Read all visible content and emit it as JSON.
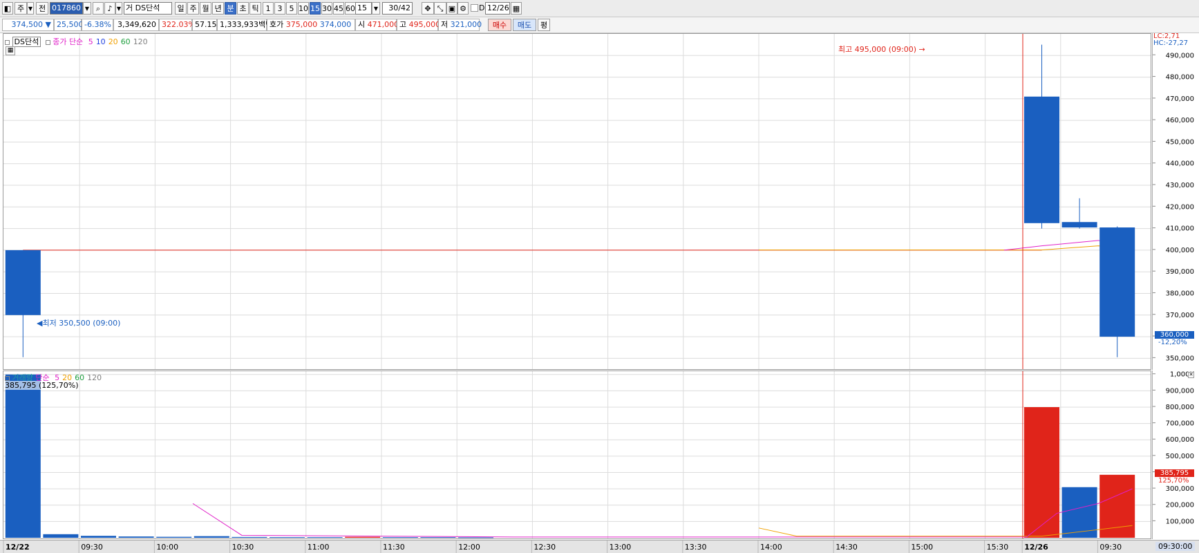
{
  "toolbar": {
    "market_label": "주",
    "jeon_label": "전",
    "code": "017860",
    "geo_label": "거",
    "stock_name": "DS단석",
    "period_buttons": [
      "일",
      "주",
      "월",
      "년",
      "분",
      "초",
      "틱"
    ],
    "period_selected": "분",
    "interval_buttons": [
      "1",
      "3",
      "5",
      "10",
      "15",
      "30",
      "45",
      "60"
    ],
    "interval_selected": "15",
    "interval_value": "15",
    "count": "30/42",
    "checkbox_label": "D",
    "date": "12/26"
  },
  "info": {
    "price": "374,500 ▼",
    "change": "25,500",
    "change_pct": "-6.38%",
    "volume": "3,349,620",
    "volume_ratio": "322.03%",
    "turnover": "57.15%",
    "amount": "1,333,933백만",
    "hoga_label": "호가",
    "ask": "375,000",
    "bid": "374,000",
    "open_label": "시",
    "open": "471,000",
    "high_label": "고",
    "high": "495,000",
    "low_label": "저",
    "low": "321,000",
    "buy_label": "매수",
    "sell_label": "매도",
    "eval_label": "평"
  },
  "price_pane": {
    "name": "DS단석",
    "ma_label": "종가 단순",
    "ma_periods": [
      "5",
      "10",
      "20",
      "60",
      "120"
    ],
    "ma_colors": [
      "#e020c8",
      "#2040e0",
      "#f0a000",
      "#20a040",
      "#808080"
    ],
    "lc_label": "LC:2,71",
    "hc_label": "HC:-27,27",
    "high_annotation": "최고 495,000 (09:00)",
    "low_annotation": "최저 350,500 (09:00)",
    "current_price_tag": "360,000",
    "current_pct_tag": "-12,20%"
  },
  "volume_pane": {
    "name": "거래량",
    "ma_label": "단순",
    "ma_periods": [
      "5",
      "20",
      "60",
      "120"
    ],
    "first_bar_label": "385,795 (125,70%)",
    "current_volume_tag": "385,795",
    "current_pct_tag": "125,70%"
  },
  "x_axis": {
    "labels": [
      "12/22",
      "09:30",
      "10:00",
      "10:30",
      "11:00",
      "11:30",
      "12:00",
      "12:30",
      "13:00",
      "13:30",
      "14:00",
      "14:30",
      "15:00",
      "15:30",
      "12/26",
      "09:30"
    ],
    "end_label": "09:30:00"
  },
  "colors": {
    "up": "#e0241a",
    "down": "#1a5fc0",
    "grid": "#dcdcdc"
  },
  "chart_data": [
    {
      "type": "candlestick",
      "title": "DS단석",
      "ylim": [
        345000,
        500000
      ],
      "yticks": [
        350000,
        360000,
        370000,
        380000,
        390000,
        400000,
        410000,
        420000,
        430000,
        440000,
        450000,
        460000,
        470000,
        480000,
        490000
      ],
      "ytick_labels": [
        "350,000",
        "360,000",
        "370,000",
        "380,000",
        "390,000",
        "400,000",
        "410,000",
        "420,000",
        "430,000",
        "440,000",
        "450,000",
        "460,000",
        "470,000",
        "480,000",
        "490,000"
      ],
      "candles": [
        {
          "slot": 0,
          "time": "12/22 09:00",
          "open": 400000,
          "high": 400000,
          "low": 350500,
          "close": 370000
        },
        {
          "slot": 27,
          "time": "12/26 09:00",
          "open": 471000,
          "high": 495000,
          "low": 410000,
          "close": 412500
        },
        {
          "slot": 28,
          "time": "12/26 09:15",
          "open": 413000,
          "high": 424000,
          "low": 410000,
          "close": 410500
        },
        {
          "slot": 29,
          "time": "12/26 09:30",
          "open": 410500,
          "high": 411000,
          "low": 350500,
          "close": 360000
        }
      ],
      "flat_line": {
        "from_slot": 0,
        "to_slot": 27,
        "value": 400000
      },
      "ma5": [
        [
          26,
          400000
        ],
        [
          27,
          402000
        ],
        [
          28.5,
          404500
        ],
        [
          29.4,
          400500
        ]
      ],
      "ma20": [
        [
          19.5,
          400100
        ],
        [
          27,
          400100
        ],
        [
          28.5,
          402000
        ],
        [
          29.4,
          400200
        ]
      ]
    },
    {
      "type": "bar",
      "title": "거래량",
      "ylim": [
        0,
        1020000
      ],
      "yticks": [
        100000,
        200000,
        300000,
        400000,
        500000,
        600000,
        700000,
        800000,
        900000,
        1000000
      ],
      "ytick_labels": [
        "100,000",
        "200,000",
        "300,000",
        "400,000",
        "500,000",
        "600,000",
        "700,000",
        "800,000",
        "900,000",
        "1,000K"
      ],
      "bars": [
        {
          "slot": 0,
          "value": 1000000,
          "color": "down"
        },
        {
          "slot": 1,
          "value": 22000,
          "color": "down"
        },
        {
          "slot": 2,
          "value": 12000,
          "color": "down"
        },
        {
          "slot": 3,
          "value": 8000,
          "color": "down"
        },
        {
          "slot": 4,
          "value": 6000,
          "color": "down"
        },
        {
          "slot": 5,
          "value": 10000,
          "color": "down"
        },
        {
          "slot": 6,
          "value": 5000,
          "color": "down"
        },
        {
          "slot": 7,
          "value": 4000,
          "color": "down"
        },
        {
          "slot": 8,
          "value": 4000,
          "color": "down"
        },
        {
          "slot": 9,
          "value": 6000,
          "color": "up"
        },
        {
          "slot": 10,
          "value": 4000,
          "color": "down"
        },
        {
          "slot": 11,
          "value": 4000,
          "color": "down"
        },
        {
          "slot": 12,
          "value": 3000,
          "color": "down"
        },
        {
          "slot": 27,
          "value": 800000,
          "color": "up"
        },
        {
          "slot": 28,
          "value": 310000,
          "color": "down"
        },
        {
          "slot": 29,
          "value": 385795,
          "color": "up"
        }
      ],
      "ma5": [
        [
          4.5,
          210000
        ],
        [
          5.8,
          15000
        ],
        [
          13,
          5000
        ],
        [
          26.6,
          5000
        ],
        [
          27.4,
          150000
        ],
        [
          28.5,
          210000
        ],
        [
          29.4,
          300000
        ]
      ],
      "ma20": [
        [
          19.5,
          60000
        ],
        [
          20.5,
          10000
        ],
        [
          27,
          10000
        ],
        [
          28.5,
          50000
        ],
        [
          29.4,
          75000
        ]
      ]
    }
  ]
}
